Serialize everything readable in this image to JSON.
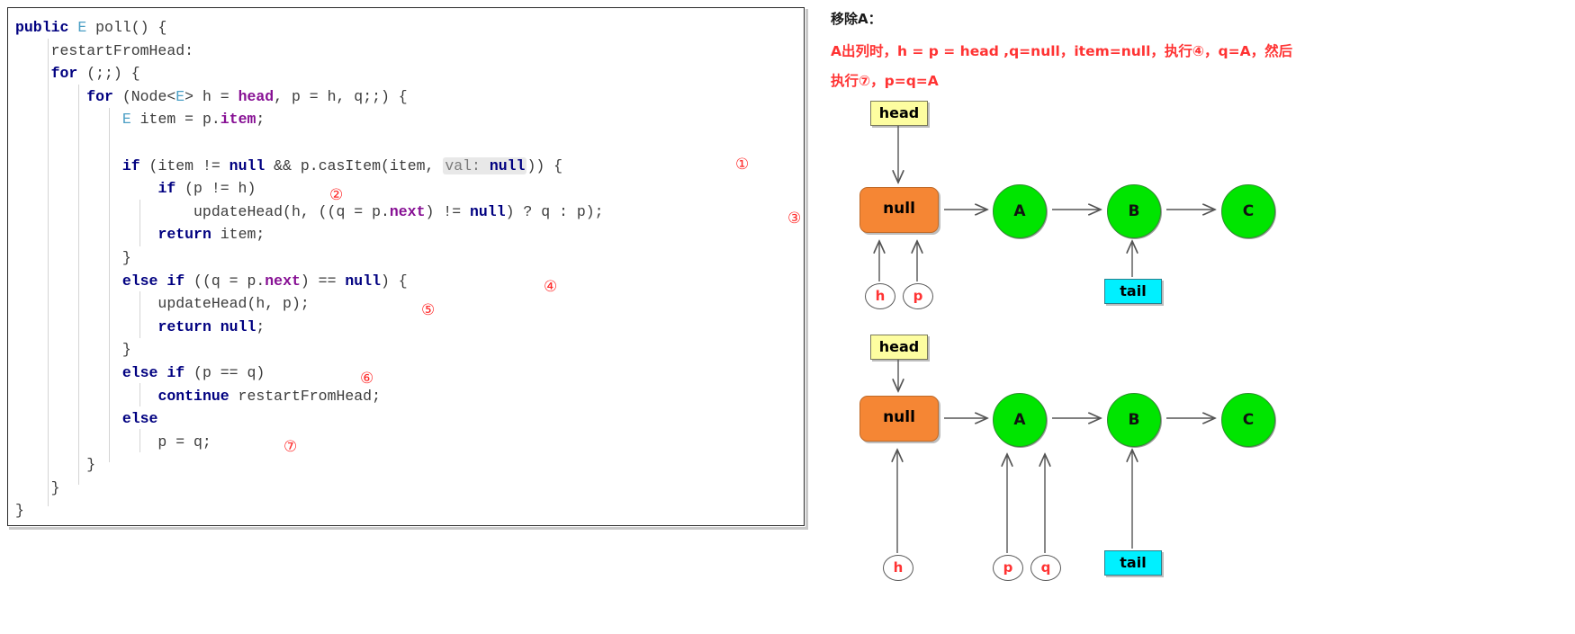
{
  "code_panel": {
    "language": "java",
    "lines": [
      "public E poll() {",
      "    restartFromHead:",
      "    for (;;) {",
      "        for (Node<E> h = head, p = h, q;;) {",
      "            E item = p.item;",
      "",
      "            if (item != null && p.casItem(item,  val: null)) {",
      "                if (p != h)",
      "                    updateHead(h, ((q = p.next) != null) ? q : p);",
      "                return item;",
      "            }",
      "            else if ((q = p.next) == null) {",
      "                updateHead(h, p);",
      "                return null;",
      "            }",
      "            else if (p == q)",
      "                continue restartFromHead;",
      "            else",
      "                p = q;",
      "        }",
      "    }",
      "}"
    ],
    "inlay_hint": "val:",
    "markers": [
      {
        "id": "1",
        "glyph": "①"
      },
      {
        "id": "2",
        "glyph": "②"
      },
      {
        "id": "3",
        "glyph": "③"
      },
      {
        "id": "4",
        "glyph": "④"
      },
      {
        "id": "5",
        "glyph": "⑤"
      },
      {
        "id": "6",
        "glyph": "⑥"
      },
      {
        "id": "7",
        "glyph": "⑦"
      }
    ]
  },
  "notes": {
    "title": "移除A：",
    "line1": "A出列时，h = p = head ,q=null，item=null，执行④，q=A，然后",
    "line2": "执行⑦，p=q=A"
  },
  "diagram": {
    "stage1": {
      "head_label": "head",
      "tail_label": "tail",
      "nodes": [
        {
          "label": "null",
          "kind": "null-node"
        },
        {
          "label": "A",
          "kind": "data-node"
        },
        {
          "label": "B",
          "kind": "data-node"
        },
        {
          "label": "C",
          "kind": "data-node"
        }
      ],
      "pointers": [
        {
          "label": "h",
          "target": "null"
        },
        {
          "label": "p",
          "target": "null"
        }
      ],
      "tail_target": "B"
    },
    "stage2": {
      "head_label": "head",
      "tail_label": "tail",
      "nodes": [
        {
          "label": "null",
          "kind": "null-node"
        },
        {
          "label": "A",
          "kind": "data-node"
        },
        {
          "label": "B",
          "kind": "data-node"
        },
        {
          "label": "C",
          "kind": "data-node"
        }
      ],
      "pointers": [
        {
          "label": "h",
          "target": "null"
        },
        {
          "label": "p",
          "target": "A"
        },
        {
          "label": "q",
          "target": "A"
        }
      ],
      "tail_target": "B"
    }
  },
  "colors": {
    "head_box": "#fdfda0",
    "tail_box": "#00f0ff",
    "null_node": "#f58634",
    "data_node": "#00e500",
    "pointer_text": "#ff3333",
    "note_text": "#ff3333",
    "keyword": "#000080",
    "marker": "#ff2a2a"
  }
}
